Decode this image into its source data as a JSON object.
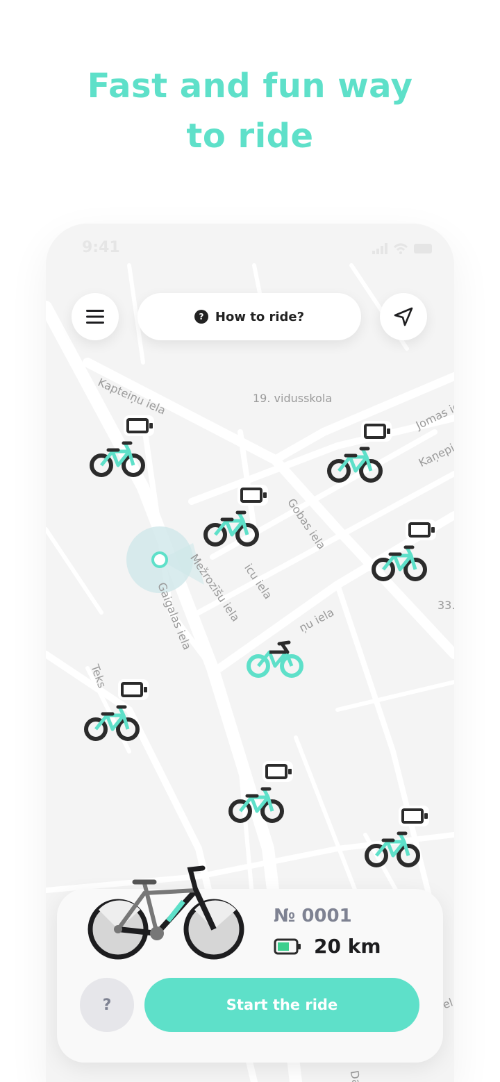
{
  "headline": {
    "line1": "Fast and fun way",
    "line2": "to ride"
  },
  "status_bar": {
    "time": "9:41"
  },
  "top_bar": {
    "how_to_ride_label": "How to ride?",
    "help_glyph": "?"
  },
  "map": {
    "streets": [
      "Kapteiņu iela",
      "19. vidusskola",
      "Jomas iel",
      "Kaņepi",
      "Gobas iela",
      "Mežrozīšu iela",
      "icu iela",
      "Gaigalas iela",
      "ņu iela",
      "Teks",
      "33.",
      "el",
      "Da"
    ]
  },
  "bike_card": {
    "number": "№ 0001",
    "range": "20 km",
    "help_label": "?",
    "start_label": "Start the ride"
  },
  "colors": {
    "accent": "#5ee0c9",
    "dark": "#2b2b2b",
    "battery_green": "#3ccf8e",
    "map_bg": "#f4f4f4"
  },
  "icons": [
    "menu-icon",
    "help-icon",
    "navigation-arrow-icon",
    "bike-icon",
    "battery-icon",
    "user-location-icon"
  ]
}
